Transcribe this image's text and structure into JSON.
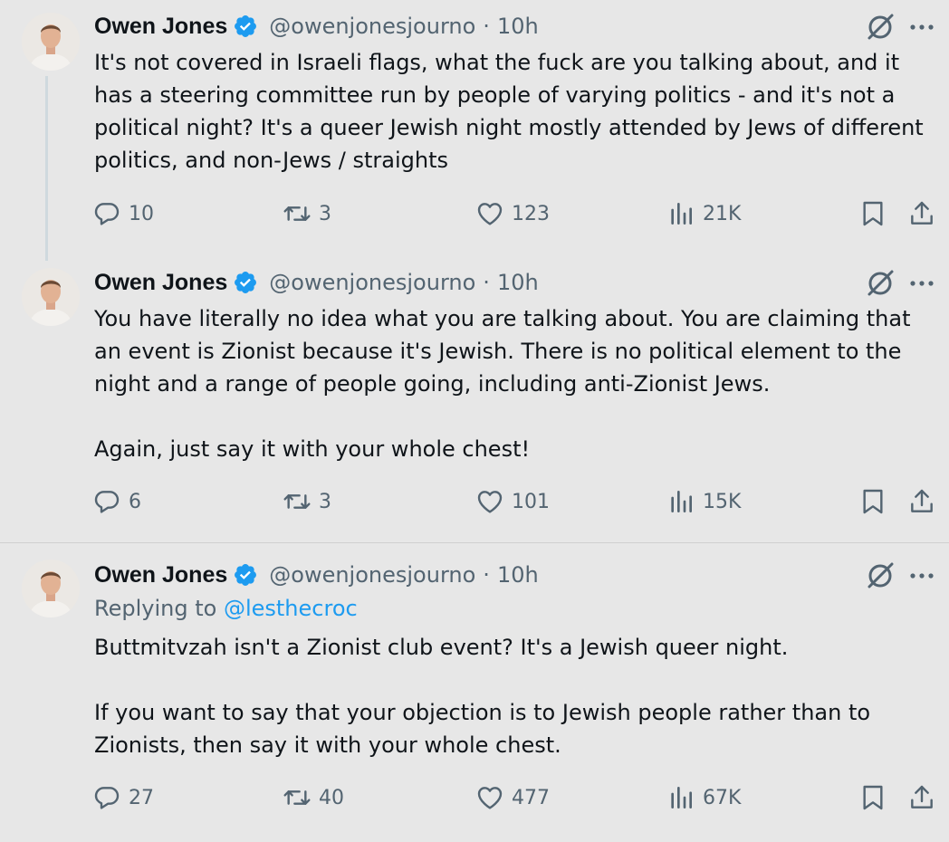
{
  "tweets": [
    {
      "author": {
        "name": "Owen Jones",
        "handle": "@owenjonesjourno",
        "separator": "·",
        "time": "10h"
      },
      "replying_to": null,
      "paragraphs": [
        "It's not covered in Israeli flags, what the fuck are you talking about, and it has a steering committee run by people of varying politics - and it's not a political night? It's a queer Jewish night mostly attended by Jews of different politics, and non-Jews / straights"
      ],
      "stats": {
        "replies": "10",
        "reposts": "3",
        "likes": "123",
        "views": "21K"
      },
      "icons": {
        "verified": "verified-badge-icon",
        "grok": "grok-icon",
        "more": "more-icon",
        "reply": "reply-icon",
        "repost": "repost-icon",
        "like": "heart-icon",
        "views": "views-icon",
        "bookmark": "bookmark-icon",
        "share": "share-icon"
      }
    },
    {
      "author": {
        "name": "Owen Jones",
        "handle": "@owenjonesjourno",
        "separator": "·",
        "time": "10h"
      },
      "replying_to": null,
      "paragraphs": [
        "You have literally no idea what you are talking about. You are claiming that an event is Zionist because it's Jewish. There is no political element to the night and a range of people going, including anti-Zionist Jews.",
        "Again, just say it with your whole chest!"
      ],
      "stats": {
        "replies": "6",
        "reposts": "3",
        "likes": "101",
        "views": "15K"
      }
    },
    {
      "author": {
        "name": "Owen Jones",
        "handle": "@owenjonesjourno",
        "separator": "·",
        "time": "10h"
      },
      "replying_to": {
        "prefix": "Replying to",
        "mention": "@lesthecroc"
      },
      "paragraphs": [
        "Buttmitvzah isn't a Zionist club event? It's a Jewish queer night.",
        "If you want to say that your objection is to Jewish people rather than to Zionists, then say it with your whole chest."
      ],
      "stats": {
        "replies": "27",
        "reposts": "40",
        "likes": "477",
        "views": "67K"
      }
    }
  ],
  "colors": {
    "background": "#e7e7e7",
    "text": "#0f1419",
    "secondary": "#536471",
    "accent": "#1d9bf0",
    "thread_line": "#cfd9de"
  }
}
